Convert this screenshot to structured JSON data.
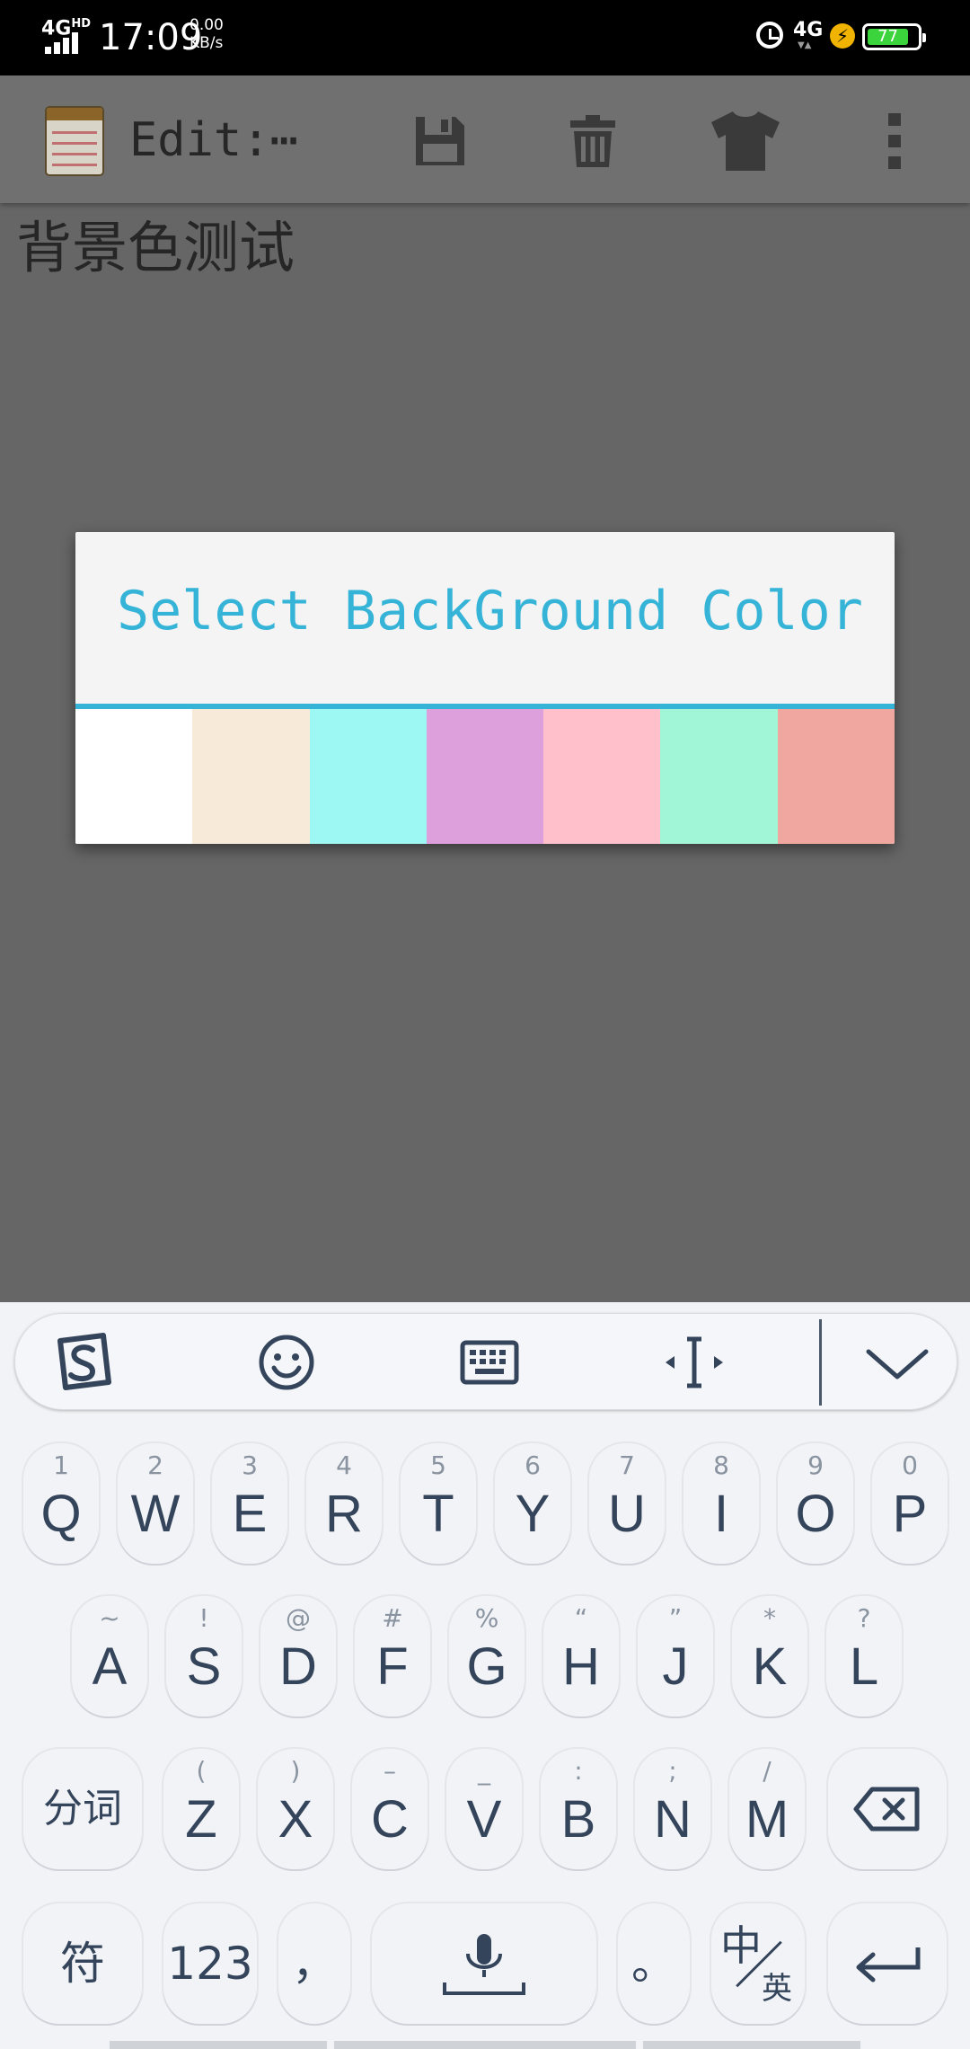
{
  "status_bar": {
    "network_type": "4G",
    "network_sup": "HD",
    "time": "17:09",
    "speed_value": "0.00",
    "speed_unit": "KB/s",
    "data_network": "4G",
    "battery_level": "77"
  },
  "app_bar": {
    "title": "Edit:⋯",
    "icons": [
      "notepad-icon",
      "save-icon",
      "delete-icon",
      "shirt-icon",
      "overflow-menu-icon"
    ]
  },
  "note": {
    "text": "背景色测试"
  },
  "dialog": {
    "title": "Select BackGround Color",
    "accent_color": "#36b4d8",
    "colors": [
      "#ffffff",
      "#f8ead8",
      "#9df8f4",
      "#dda0dc",
      "#ffc0cb",
      "#a2f6d8",
      "#f0a7a0"
    ]
  },
  "keyboard": {
    "toolbar_icons": [
      "sogou-logo-icon",
      "emoji-icon",
      "keyboard-icon",
      "cursor-move-icon",
      "collapse-chevron-icon"
    ],
    "row1": [
      {
        "main": "Q",
        "sub": "1"
      },
      {
        "main": "W",
        "sub": "2"
      },
      {
        "main": "E",
        "sub": "3"
      },
      {
        "main": "R",
        "sub": "4"
      },
      {
        "main": "T",
        "sub": "5"
      },
      {
        "main": "Y",
        "sub": "6"
      },
      {
        "main": "U",
        "sub": "7"
      },
      {
        "main": "I",
        "sub": "8"
      },
      {
        "main": "O",
        "sub": "9"
      },
      {
        "main": "P",
        "sub": "0"
      }
    ],
    "row2": [
      {
        "main": "A",
        "sub": "~"
      },
      {
        "main": "S",
        "sub": "!"
      },
      {
        "main": "D",
        "sub": "@"
      },
      {
        "main": "F",
        "sub": "#"
      },
      {
        "main": "G",
        "sub": "%"
      },
      {
        "main": "H",
        "sub": "“"
      },
      {
        "main": "J",
        "sub": "”"
      },
      {
        "main": "K",
        "sub": "*"
      },
      {
        "main": "L",
        "sub": "?"
      }
    ],
    "row3_left": "分词",
    "row3": [
      {
        "main": "Z",
        "sub": "("
      },
      {
        "main": "X",
        "sub": ")"
      },
      {
        "main": "C",
        "sub": "–"
      },
      {
        "main": "V",
        "sub": "_"
      },
      {
        "main": "B",
        "sub": ":"
      },
      {
        "main": "N",
        "sub": ";"
      },
      {
        "main": "M",
        "sub": "/"
      }
    ],
    "row4": {
      "symbols": "符",
      "numbers": "123",
      "comma": "，",
      "period": "。",
      "lang_main": "中",
      "lang_sub": "英"
    }
  }
}
